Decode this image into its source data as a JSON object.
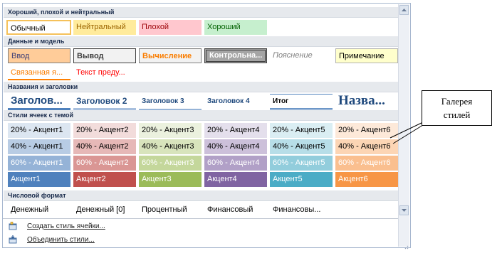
{
  "gallery": {
    "sections": {
      "good_bad": "Хороший, плохой и нейтральный",
      "data_model": "Данные и модель",
      "titles": "Названия и заголовки",
      "themed": "Стили ячеек с темой",
      "number_format": "Числовой формат"
    },
    "good_bad_row": [
      "Обычный",
      "Нейтральный",
      "Плохой",
      "Хороший"
    ],
    "data_model_row1": [
      "Ввод",
      "Вывод",
      "Вычисление",
      "Контрольна...",
      "Пояснение",
      "Примечание"
    ],
    "data_model_row2": [
      "Связанная я...",
      "Текст преду..."
    ],
    "titles_row": [
      "Заголов...",
      "Заголовок 2",
      "Заголовок 3",
      "Заголовок 4",
      "Итог",
      "Назва..."
    ],
    "themed_20": [
      "20% - Акцент1",
      "20% - Акцент2",
      "20% - Акцент3",
      "20% - Акцент4",
      "20% - Акцент5",
      "20% - Акцент6"
    ],
    "themed_40": [
      "40% - Акцент1",
      "40% - Акцент2",
      "40% - Акцент3",
      "40% - Акцент4",
      "40% - Акцент5",
      "40% - Акцент6"
    ],
    "themed_60": [
      "60% - Акцент1",
      "60% - Акцент2",
      "60% - Акцент3",
      "60% - Акцент4",
      "60% - Акцент5",
      "60% - Акцент6"
    ],
    "themed_100": [
      "Акцент1",
      "Акцент2",
      "Акцент3",
      "Акцент4",
      "Акцент5",
      "Акцент6"
    ],
    "number_row": [
      "Денежный",
      "Денежный [0]",
      "Процентный",
      "Финансовый",
      "Финансовы..."
    ]
  },
  "footer": {
    "create_style": "Создать стиль ячейки...",
    "merge_styles": "Объединить стили..."
  },
  "callout": {
    "line1": "Галерея",
    "line2": "стилей"
  },
  "colors": {
    "accent1_20": "#dce6f1",
    "accent2_20": "#f2dcdb",
    "accent3_20": "#ebf1de",
    "accent4_20": "#e4dfec",
    "accent5_20": "#daeef3",
    "accent6_20": "#fde9d9",
    "accent1_40": "#b8cce4",
    "accent2_40": "#e6b8b7",
    "accent3_40": "#d8e4bc",
    "accent4_40": "#ccc0da",
    "accent5_40": "#b7dee8",
    "accent6_40": "#fcd5b4",
    "accent1_60": "#95b3d7",
    "accent2_60": "#da9694",
    "accent3_60": "#c4d79b",
    "accent4_60": "#b1a0c7",
    "accent5_60": "#92cddc",
    "accent6_60": "#fabf8f",
    "accent1": "#4f81bd",
    "accent2": "#c0504d",
    "accent3": "#9bbb59",
    "accent4": "#8064a2",
    "accent5": "#4bacc6",
    "accent6": "#f79646"
  }
}
